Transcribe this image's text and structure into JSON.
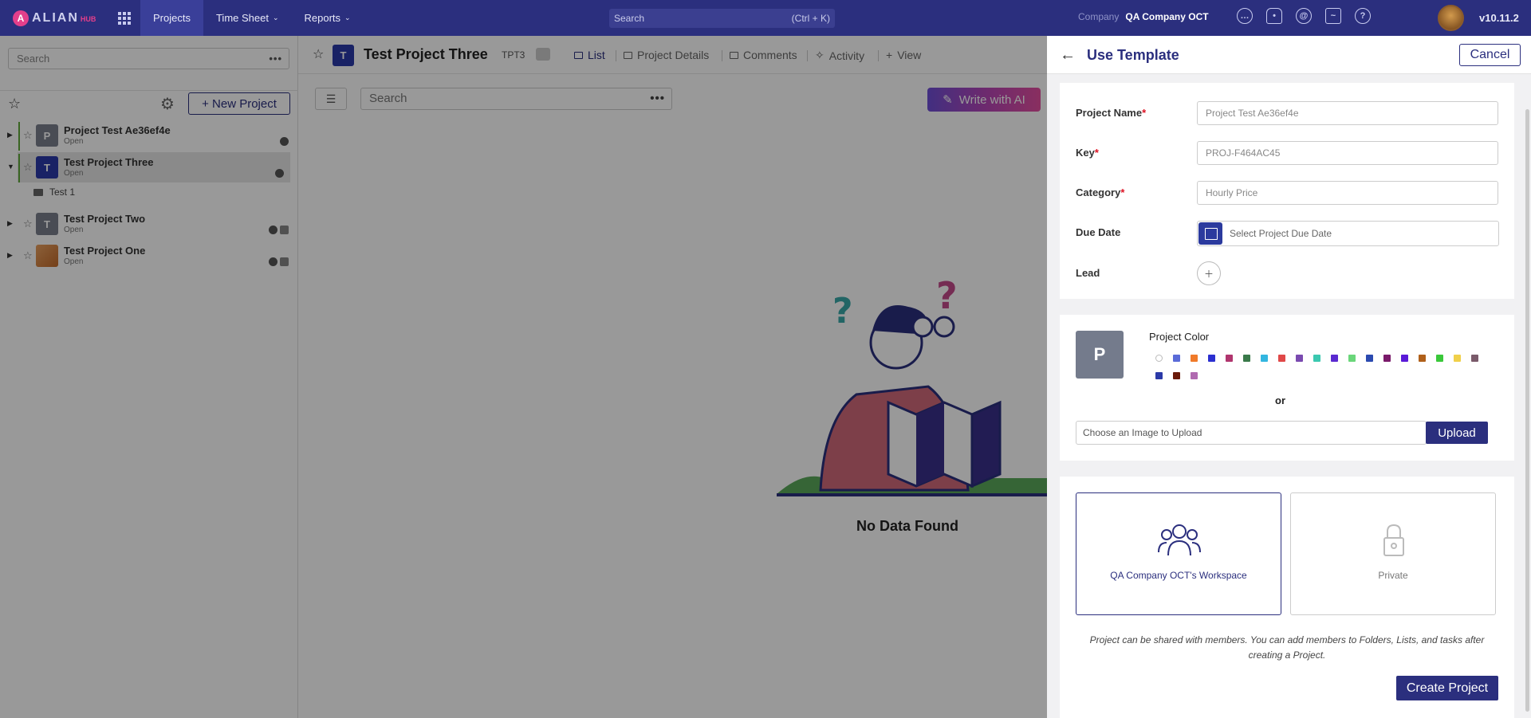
{
  "topnav": {
    "logo_text": "ALIAN",
    "logo_sub": "HUB",
    "items": [
      {
        "label": "Projects",
        "active": true
      },
      {
        "label": "Time Sheet",
        "dropdown": true
      },
      {
        "label": "Reports",
        "dropdown": true
      }
    ],
    "search_placeholder": "Search",
    "search_shortcut": "(Ctrl + K)",
    "company_label": "Company",
    "company_name": "QA Company OCT",
    "icons": [
      "chat-icon",
      "bell-icon",
      "at-icon",
      "integrations-icon",
      "help-icon"
    ],
    "version": "v10.11.2"
  },
  "sidebar": {
    "search_placeholder": "Search",
    "new_project_label": "+ New Project",
    "projects": [
      {
        "name": "Project Test Ae36ef4e",
        "status": "Open",
        "avatar": "P",
        "color": "#7a7f8c"
      },
      {
        "name": "Test Project Three",
        "status": "Open",
        "avatar": "T",
        "color": "#2b3aa8",
        "selected": true
      },
      {
        "name": "Test Project Two",
        "status": "Open",
        "avatar": "T",
        "color": "#7a7f8c"
      },
      {
        "name": "Test Project One",
        "status": "Open",
        "avatar": "",
        "color": "#d28a4a"
      }
    ],
    "subfolder": "Test 1"
  },
  "main": {
    "project_avatar": "T",
    "project_title": "Test Project Three",
    "project_key": "TPT3",
    "tabs": [
      "List",
      "Project Details",
      "Comments",
      "Activity",
      "View"
    ],
    "search_placeholder": "Search",
    "ai_button": "Write with AI",
    "empty_text": "No Data Found"
  },
  "panel": {
    "title": "Use Template",
    "cancel_label": "Cancel",
    "fields": {
      "name_label": "Project Name",
      "name_placeholder": "Project Test Ae36ef4e",
      "key_label": "Key",
      "key_placeholder": "PROJ-F464AC45",
      "category_label": "Category",
      "category_placeholder": "Hourly Price",
      "due_label": "Due Date",
      "due_placeholder": "Select Project Due Date",
      "lead_label": "Lead",
      "required_mark": "*"
    },
    "color": {
      "avatar_letter": "P",
      "label": "Project Color",
      "swatches": [
        "#ffffff",
        "#5a6bd8",
        "#f07a2a",
        "#2b2fd0",
        "#b0356e",
        "#3a7a4a",
        "#33b6e0",
        "#e04848",
        "#7a4ab0",
        "#3bc8b0",
        "#5a2ad0",
        "#6ad67a",
        "#2b4ab0",
        "#7a1a6a",
        "#5a1ad8",
        "#b0601a",
        "#3ac83a",
        "#f0d04a",
        "#7a5a6a",
        "#2b3aa8",
        "#6a1a0a",
        "#b06ab0"
      ],
      "or_text": "or",
      "upload_placeholder": "Choose an Image to Upload",
      "upload_label": "Upload"
    },
    "visibility": {
      "workspace_label": "QA Company OCT's Workspace",
      "private_label": "Private"
    },
    "share_note": "Project can be shared with members. You can add members to Folders, Lists, and tasks after creating a Project.",
    "create_label": "Create Project"
  }
}
